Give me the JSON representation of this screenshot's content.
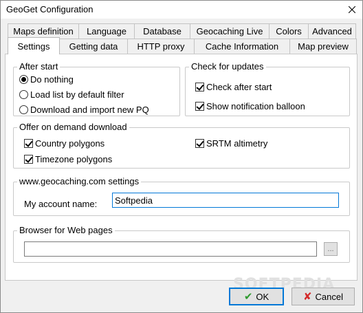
{
  "window": {
    "title": "GeoGet Configuration"
  },
  "tabs": {
    "row_back": [
      "Maps definition",
      "Language",
      "Database",
      "Geocaching Live",
      "Colors",
      "Advanced"
    ],
    "row_front": [
      "Settings",
      "Getting data",
      "HTTP proxy",
      "Cache Information",
      "Map preview"
    ],
    "active": "Settings"
  },
  "after_start": {
    "title": "After start",
    "options": [
      "Do nothing",
      "Load list by default filter",
      "Download and import new PQ"
    ],
    "selected": "Do nothing"
  },
  "check_updates": {
    "title": "Check for updates",
    "options": [
      {
        "label": "Check after start",
        "checked": true
      },
      {
        "label": "Show notification balloon",
        "checked": true
      }
    ]
  },
  "on_demand": {
    "title": "Offer on demand download",
    "options": [
      {
        "label": "Country polygons",
        "checked": true
      },
      {
        "label": "SRTM altimetry",
        "checked": true
      },
      {
        "label": "Timezone polygons",
        "checked": true
      }
    ]
  },
  "geocaching": {
    "title": "www.geocaching.com settings",
    "account_label": "My account name:",
    "account_value": "Softpedia"
  },
  "browser": {
    "title": "Browser for Web pages",
    "path_value": "",
    "browse_label": "..."
  },
  "buttons": {
    "ok": "OK",
    "cancel": "Cancel"
  },
  "colors": {
    "accent": "#0078d7",
    "ok_icon": "#2e9a2e",
    "cancel_icon": "#d42a2a"
  }
}
